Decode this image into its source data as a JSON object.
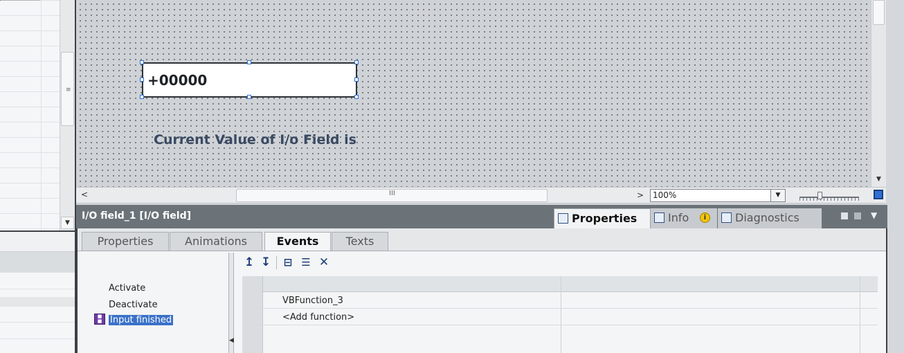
{
  "canvas": {
    "io_field_value": "+00000",
    "static_text": "Current Value of I/o Field is"
  },
  "toolbar_bottom": {
    "zoom_value": "100%",
    "grip": "III"
  },
  "inspector": {
    "title": "I/O field_1 [I/O field]",
    "tabs": [
      {
        "label": "Properties",
        "active": true,
        "icon": "properties-icon"
      },
      {
        "label": "Info",
        "active": false,
        "icon": "info-icon"
      },
      {
        "label": "Diagnostics",
        "active": false,
        "icon": "diagnostics-icon"
      }
    ],
    "subtabs": [
      {
        "label": "Properties"
      },
      {
        "label": "Animations"
      },
      {
        "label": "Events",
        "active": true
      },
      {
        "label": "Texts"
      }
    ],
    "events": [
      {
        "label": "Activate"
      },
      {
        "label": "Deactivate"
      },
      {
        "label": "Input finished",
        "selected": true
      }
    ],
    "function_rows": [
      {
        "label": "VBFunction_3"
      },
      {
        "label": "<Add function>"
      }
    ],
    "event_toolbar_icons": [
      "move-up-icon",
      "move-down-icon",
      "expand-icon",
      "collapse-icon",
      "delete-icon"
    ]
  }
}
